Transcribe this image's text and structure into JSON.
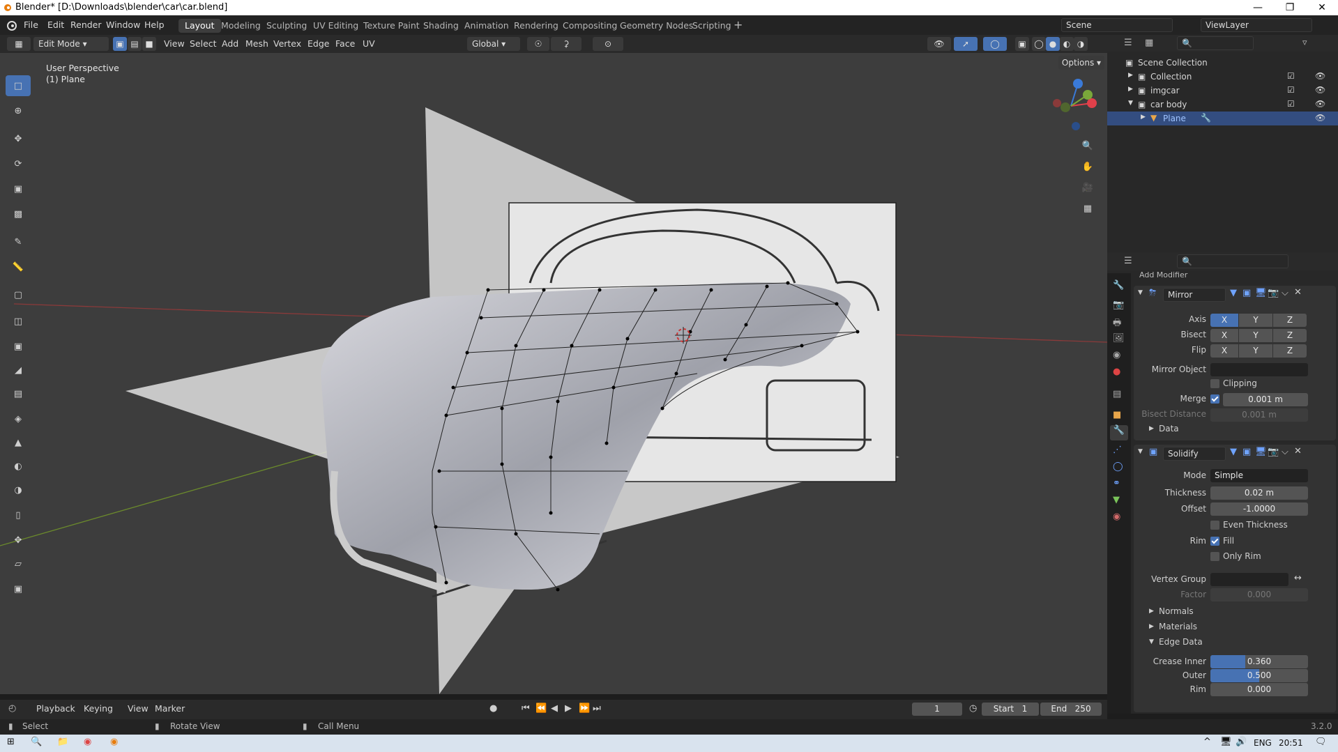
{
  "window": {
    "title": "Blender* [D:\\Downloads\\blender\\car\\car.blend]"
  },
  "menu": [
    "File",
    "Edit",
    "Render",
    "Window",
    "Help"
  ],
  "workspaces": [
    "Layout",
    "Modeling",
    "Sculpting",
    "UV Editing",
    "Texture Paint",
    "Shading",
    "Animation",
    "Rendering",
    "Compositing",
    "Geometry Nodes",
    "Scripting"
  ],
  "scene": {
    "name": "Scene",
    "view_layer": "ViewLayer"
  },
  "viewport_header": {
    "mode": "Edit Mode",
    "menus": [
      "View",
      "Select",
      "Add",
      "Mesh",
      "Vertex",
      "Edge",
      "Face",
      "UV"
    ],
    "orientation": "Global",
    "options_label": "Options",
    "axes": [
      "X",
      "Y",
      "Z"
    ]
  },
  "viewport": {
    "perspective": "User Perspective",
    "object": "(1) Plane"
  },
  "outliner": {
    "root": "Scene Collection",
    "items": [
      {
        "name": "Collection"
      },
      {
        "name": "imgcar"
      },
      {
        "name": "car body"
      },
      {
        "name": "Plane",
        "selected": true
      }
    ]
  },
  "properties": {
    "add_modifier": "Add Modifier",
    "mirror": {
      "name": "Mirror",
      "axis_label": "Axis",
      "bisect_label": "Bisect",
      "flip_label": "Flip",
      "xyz": [
        "X",
        "Y",
        "Z"
      ],
      "mirror_object_label": "Mirror Object",
      "clipping_label": "Clipping",
      "merge_label": "Merge",
      "merge_value": "0.001 m",
      "bisect_distance_label": "Bisect Distance",
      "bisect_distance_value": "0.001 m",
      "data_label": "Data"
    },
    "solidify": {
      "name": "Solidify",
      "mode_label": "Mode",
      "mode_value": "Simple",
      "thickness_label": "Thickness",
      "thickness_value": "0.02 m",
      "offset_label": "Offset",
      "offset_value": "-1.0000",
      "even_thickness_label": "Even Thickness",
      "rim_label": "Rim",
      "fill_label": "Fill",
      "only_rim_label": "Only Rim",
      "vertex_group_label": "Vertex Group",
      "factor_label": "Factor",
      "factor_value": "0.000",
      "normals_label": "Normals",
      "materials_label": "Materials",
      "edge_data_label": "Edge Data",
      "crease_inner_label": "Crease Inner",
      "crease_inner_value": "0.360",
      "crease_inner_fraction": 0.36,
      "outer_label": "Outer",
      "outer_value": "0.500",
      "outer_fraction": 0.5,
      "rim_crease_label": "Rim",
      "rim_crease_value": "0.000"
    }
  },
  "timeline": {
    "menus": [
      "Playback",
      "Keying",
      "View",
      "Marker"
    ],
    "frame": "1",
    "start_label": "Start",
    "start": "1",
    "end_label": "End",
    "end": "250"
  },
  "statusbar": {
    "select": "Select",
    "rotate": "Rotate View",
    "call_menu": "Call Menu",
    "version": "3.2.0"
  },
  "taskbar": {
    "lang": "ENG",
    "time": "20:51"
  },
  "colors": {
    "accent": "#4772b3",
    "x_axis": "#e0404a",
    "y_axis": "#7aa83a",
    "z_axis": "#3a7ad8"
  }
}
